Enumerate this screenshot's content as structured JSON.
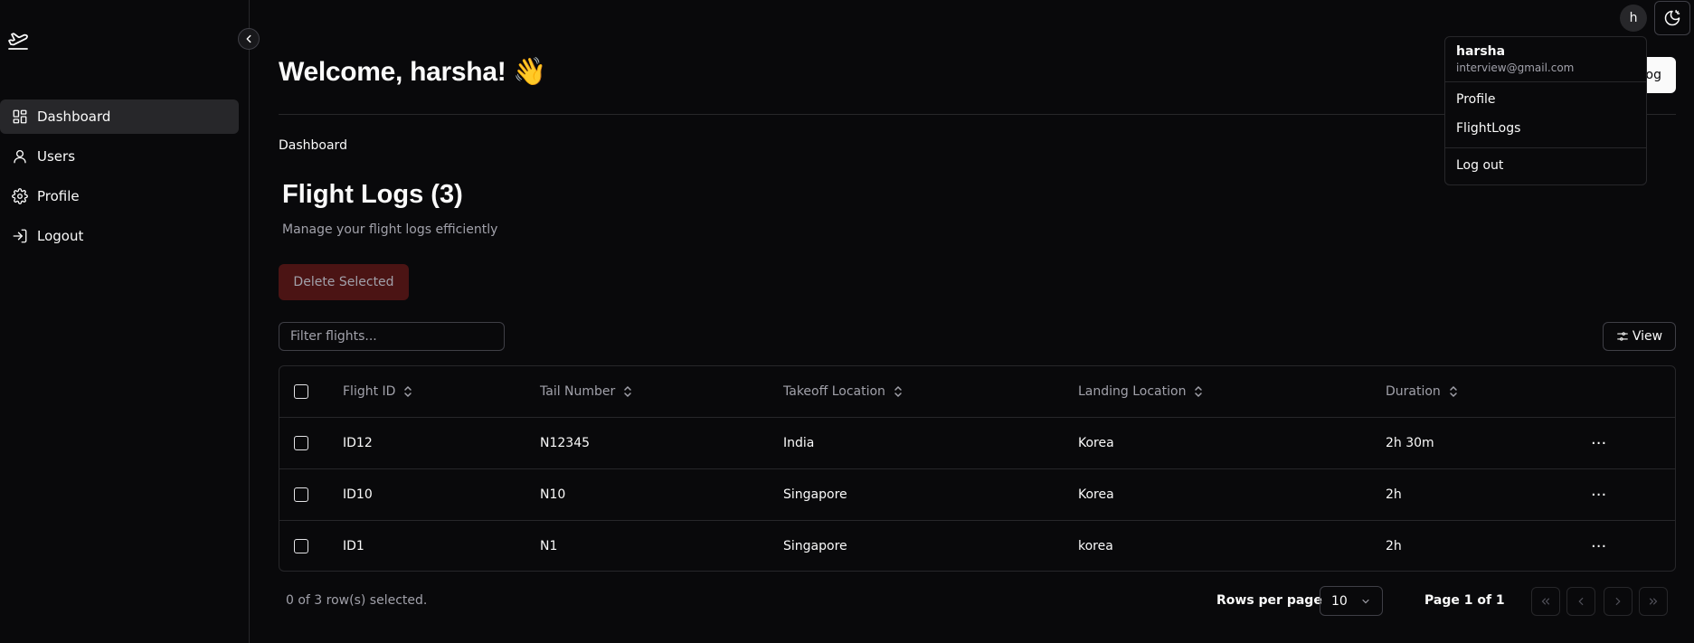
{
  "header": {
    "welcome": "Welcome, harsha! 👋",
    "add_button_partial": "og",
    "avatar_initial": "h"
  },
  "sidebar": {
    "items": [
      {
        "label": "Dashboard",
        "icon": "dashboard-icon",
        "active": true
      },
      {
        "label": "Users",
        "icon": "user-icon"
      },
      {
        "label": "Profile",
        "icon": "gear-icon"
      },
      {
        "label": "Logout",
        "icon": "logout-icon"
      }
    ]
  },
  "breadcrumb": "Dashboard",
  "page": {
    "title": "Flight Logs (3)",
    "subtitle": "Manage your flight logs efficiently",
    "delete_label": "Delete Selected",
    "filter_placeholder": "Filter flights...",
    "view_label": "View"
  },
  "table": {
    "columns": [
      "Flight ID",
      "Tail Number",
      "Takeoff Location",
      "Landing Location",
      "Duration"
    ],
    "rows": [
      [
        "ID12",
        "N12345",
        "India",
        "Korea",
        "2h 30m"
      ],
      [
        "ID10",
        "N10",
        "Singapore",
        "Korea",
        "2h"
      ],
      [
        "ID1",
        "N1",
        "Singapore",
        "korea",
        "2h"
      ]
    ],
    "actions_glyph": "···"
  },
  "footer": {
    "selected": "0 of 3 row(s) selected.",
    "rows_per_page_label": "Rows per page",
    "rows_per_page_value": "10",
    "page": "Page 1 of 1"
  },
  "user_menu": {
    "name": "harsha",
    "email": "interview@gmail.com",
    "items": [
      "Profile",
      "FlightLogs"
    ],
    "logout": "Log out"
  },
  "colors": {
    "background": "#09090b",
    "border": "#27272a",
    "delete_bg": "#4b1414",
    "text_muted": "#a1a1aa"
  }
}
